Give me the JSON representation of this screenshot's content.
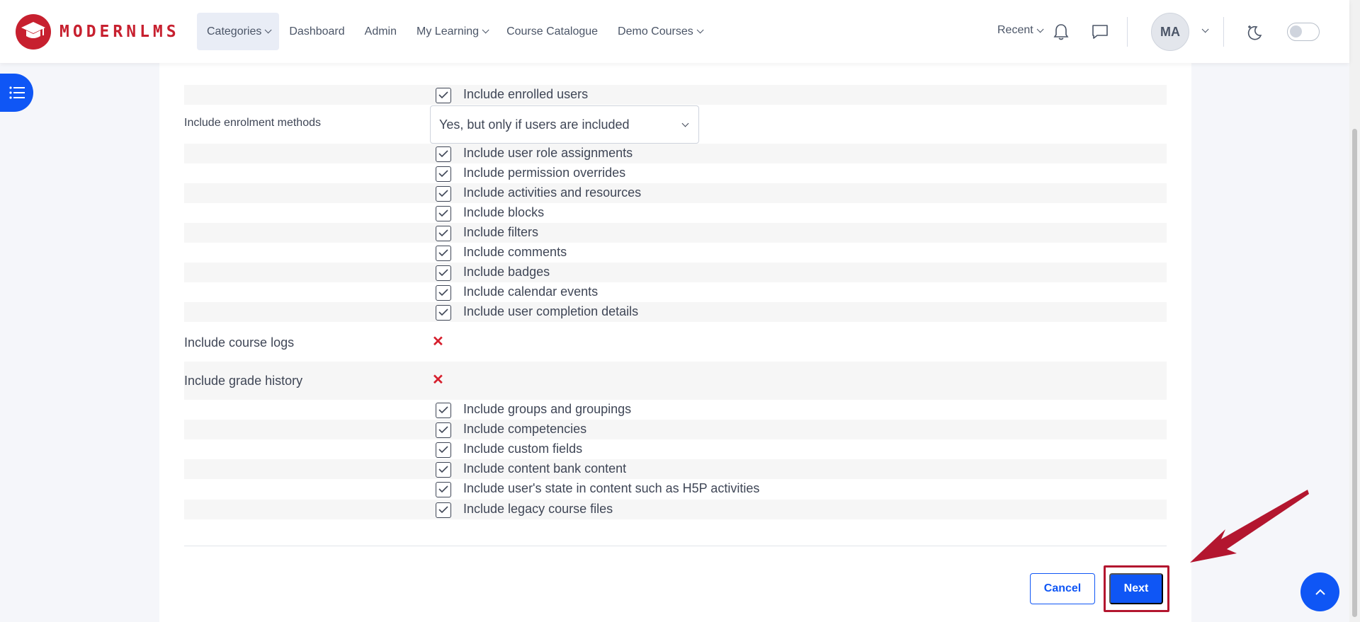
{
  "brand": {
    "name": "MODERNLMS",
    "icon": "graduation-cap-icon"
  },
  "nav": [
    {
      "label": "Categories",
      "has_caret": true
    },
    {
      "label": "Dashboard",
      "has_caret": false
    },
    {
      "label": "Admin",
      "has_caret": false
    },
    {
      "label": "My Learning",
      "has_caret": true
    },
    {
      "label": "Course Catalogue",
      "has_caret": false
    },
    {
      "label": "Demo Courses",
      "has_caret": true
    }
  ],
  "header": {
    "recent_label": "Recent",
    "avatar_initials": "MA",
    "icons": [
      "bell-icon",
      "chat-icon",
      "dark-mode-icon",
      "theme-toggle"
    ]
  },
  "settings": {
    "include_enrolled_users": "Include enrolled users",
    "enrolment_methods_label": "Include enrolment methods",
    "enrolment_methods_value": "Yes, but only if users are included",
    "checks_a": [
      "Include user role assignments",
      "Include permission overrides",
      "Include activities and resources",
      "Include blocks",
      "Include filters",
      "Include comments",
      "Include badges",
      "Include calendar events",
      "Include user completion details"
    ],
    "course_logs_label": "Include course logs",
    "grade_history_label": "Include grade history",
    "checks_b": [
      "Include groups and groupings",
      "Include competencies",
      "Include custom fields",
      "Include content bank content",
      "Include user's state in content such as H5P activities",
      "Include legacy course files"
    ]
  },
  "buttons": {
    "cancel": "Cancel",
    "next": "Next"
  },
  "colors": {
    "primary": "#0f56f5",
    "brand": "#c7202f",
    "annotation": "#b3162f"
  }
}
